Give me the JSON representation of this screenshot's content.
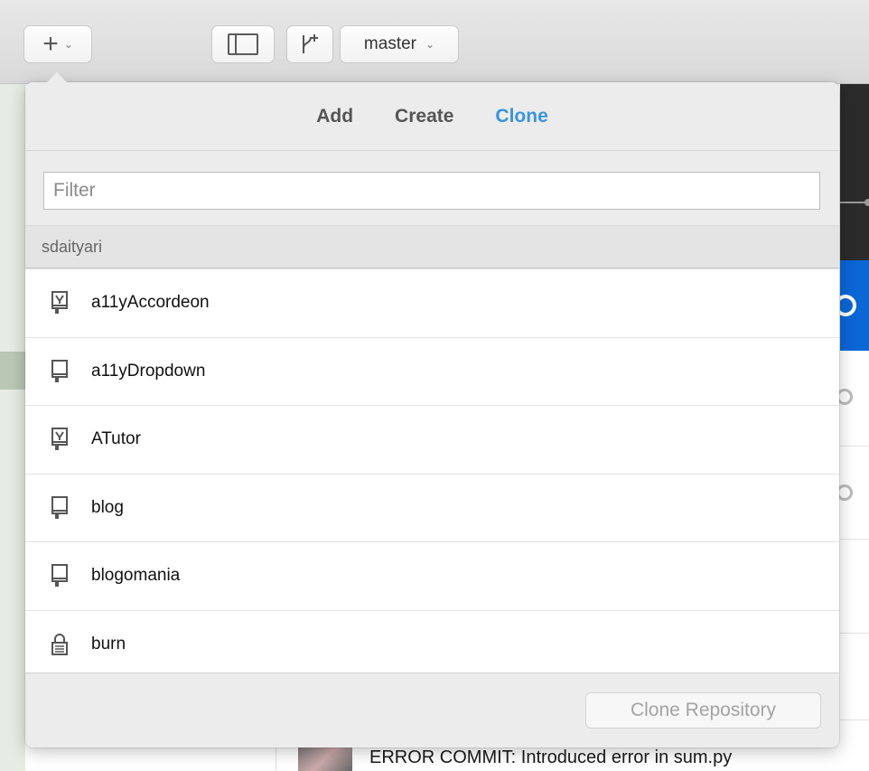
{
  "toolbar": {
    "add_button_icon": "plus-icon",
    "branch_name": "master"
  },
  "popover": {
    "tabs": [
      {
        "label": "Add",
        "active": false
      },
      {
        "label": "Create",
        "active": false
      },
      {
        "label": "Clone",
        "active": true
      }
    ],
    "filter_placeholder": "Filter",
    "account": "sdaityari",
    "repos": [
      {
        "name": "a11yAccordeon",
        "icon": "fork-repo-icon"
      },
      {
        "name": "a11yDropdown",
        "icon": "repo-icon"
      },
      {
        "name": "ATutor",
        "icon": "fork-repo-icon"
      },
      {
        "name": "blog",
        "icon": "repo-icon"
      },
      {
        "name": "blogomania",
        "icon": "repo-icon"
      },
      {
        "name": "burn",
        "icon": "lock-icon"
      }
    ],
    "clone_button_label": "Clone Repository"
  },
  "background": {
    "commit_message": "ERROR COMMIT: Introduced error in sum.py"
  },
  "colors": {
    "accent": "#3a94dc",
    "selection_blue": "#0b66d6"
  }
}
